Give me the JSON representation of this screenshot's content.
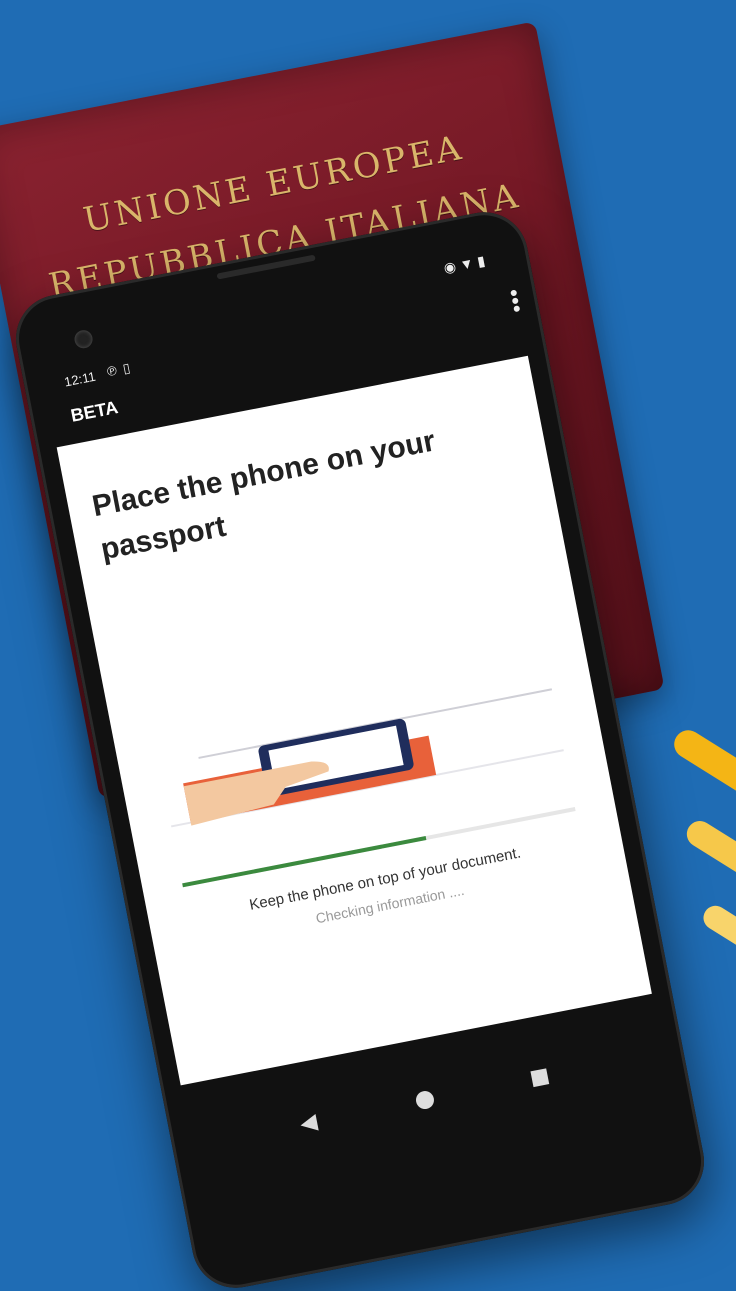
{
  "passport": {
    "line1": "UNIONE EUROPEA",
    "line2": "REPUBBLICA ITALIANA"
  },
  "phone": {
    "status_time": "12:11",
    "app_label": "BETA",
    "screen_title": "Place the phone on your passport",
    "hint": "Keep the phone on top of your document.",
    "status": "Checking information ....",
    "progress": 0.62
  },
  "colors": {
    "background": "#1f6cb4",
    "passport": "#7a1b27",
    "progress": "#3b8a3e",
    "accent": "#f4b515"
  }
}
